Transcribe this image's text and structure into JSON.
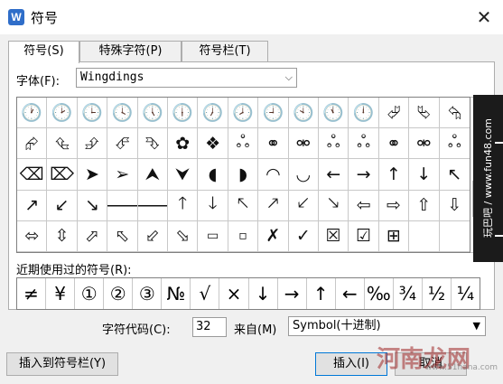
{
  "window": {
    "title": "符号",
    "logo_text": "W",
    "close_label": "✕"
  },
  "tabs": [
    {
      "label": "符号(S)",
      "active": true
    },
    {
      "label": "特殊字符(P)",
      "active": false
    },
    {
      "label": "符号栏(T)",
      "active": false
    }
  ],
  "font": {
    "label": "字体(F):",
    "value": "Wingdings",
    "arrow": "⌵"
  },
  "symbols": [
    "🕐",
    "🕑",
    "🕒",
    "🕓",
    "🕔",
    "🕕",
    "🕖",
    "🕗",
    "🕘",
    "🕙",
    "🕚",
    "🕛",
    "⮰",
    "⮱",
    "⮲",
    "⮳",
    "⮴",
    "⮵",
    "⮶",
    "⮷",
    "✿",
    "❖",
    "ஃ",
    "⚭",
    "⚮",
    "ஃ",
    "ஃ",
    "⚭",
    "⚮",
    "ஃ",
    "⌫",
    "⌦",
    "➤",
    "➢",
    "⮝",
    "⮟",
    "◖",
    "◗",
    "◠",
    "◡",
    "←",
    "→",
    "↑",
    "↓",
    "↖",
    "↗",
    "↙",
    "↘",
    "🡐",
    "🡒",
    "🡑",
    "🡓",
    "🡔",
    "🡕",
    "🡗",
    "🡖",
    "⇦",
    "⇨",
    "⇧",
    "⇩",
    "⬄",
    "⇳",
    "⬀",
    "⬁",
    "⬃",
    "⬂",
    "▭",
    "▫",
    "✗",
    "✓",
    "☒",
    "☑",
    "⊞",
    "",
    ""
  ],
  "recent": {
    "label": "近期使用过的符号(R):",
    "items": [
      "≠",
      "¥",
      "①",
      "②",
      "③",
      "№",
      "√",
      "×",
      "↓",
      "→",
      "↑",
      "←",
      "‰",
      "¾",
      "½",
      "¼"
    ]
  },
  "code": {
    "label": "字符代码(C):",
    "value": "32",
    "from_label": "来自(M)",
    "from_value": "Symbol(十进制)",
    "arrow": "▼"
  },
  "buttons": {
    "insert_to_bar": "插入到符号栏(Y)",
    "insert": "插入(I)",
    "cancel": "取消"
  },
  "watermark": {
    "text": "玩巴吧 / www.fun48.com",
    "site": "河南龙网",
    "site_sub": "www.51hana.com"
  },
  "colors": {
    "logo": "#2f6ec9",
    "accent": "#0078d7"
  }
}
